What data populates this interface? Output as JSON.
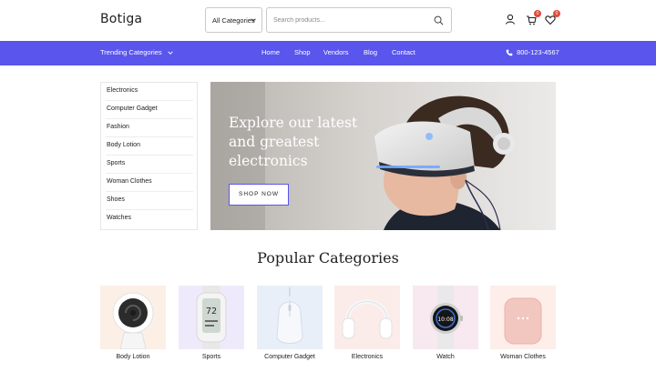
{
  "header": {
    "logo": "Botiga",
    "category_select": "All Categories",
    "search_placeholder": "Search products...",
    "cart_count": "0",
    "wishlist_count": "0"
  },
  "nav": {
    "trending": "Trending Categories",
    "links": [
      "Home",
      "Shop",
      "Vendors",
      "Blog",
      "Contact"
    ],
    "phone": "800-123-4567"
  },
  "sidebar": {
    "items": [
      "Electronics",
      "Computer Gadget",
      "Fashion",
      "Body Lotion",
      "Sports",
      "Woman Clothes",
      "Shoes",
      "Watches"
    ]
  },
  "hero": {
    "title_lines": [
      "Explore our latest",
      "and greatest",
      "electronics"
    ],
    "button": "SHOP NOW"
  },
  "popular": {
    "title": "Popular Categories",
    "categories": [
      {
        "label": "Body Lotion",
        "bg": "#fcefe6"
      },
      {
        "label": "Sports",
        "bg": "#efeafb"
      },
      {
        "label": "Computer Gadget",
        "bg": "#e9eff9"
      },
      {
        "label": "Electronics",
        "bg": "#fbecea"
      },
      {
        "label": "Watch",
        "bg": "#f8e8ef"
      },
      {
        "label": "Woman Clothes",
        "bg": "#fdeeea"
      }
    ]
  },
  "colors": {
    "accent": "#5a55ec",
    "badge": "#e0493b"
  }
}
